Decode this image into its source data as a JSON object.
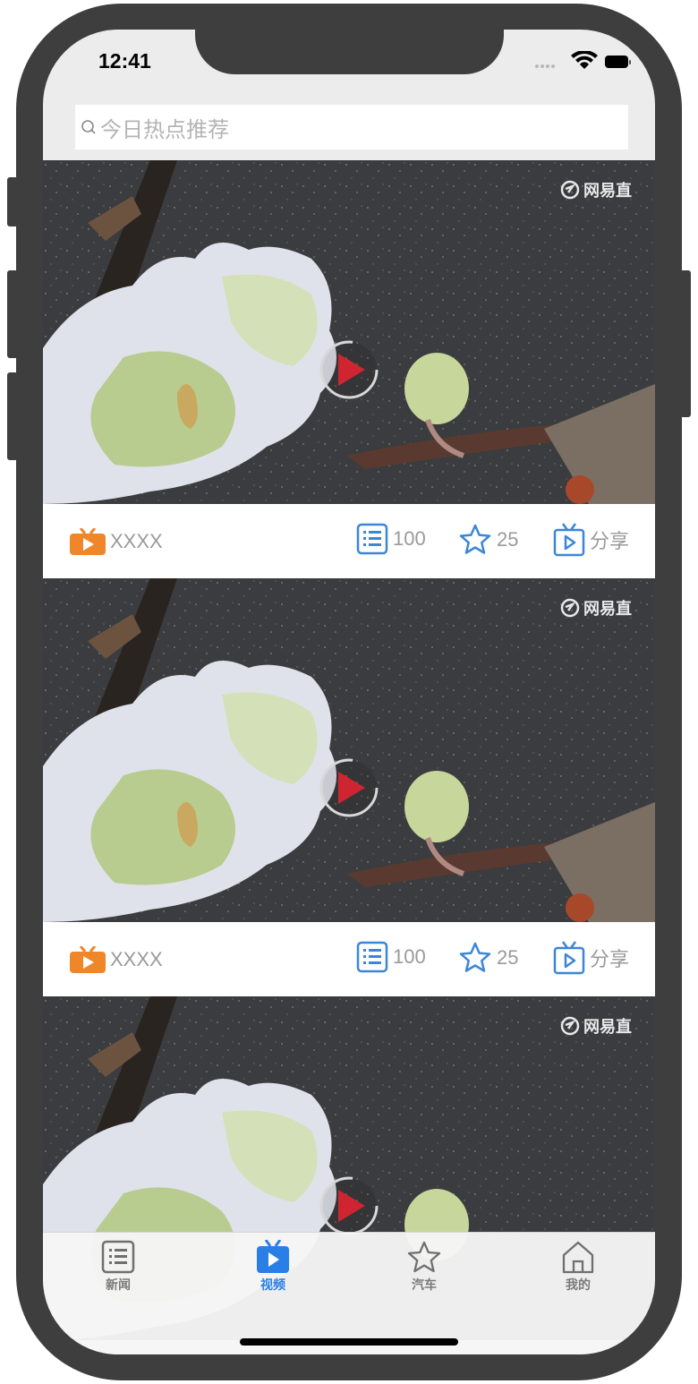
{
  "status_bar": {
    "time": "12:41"
  },
  "search": {
    "placeholder": "今日热点推荐"
  },
  "feed": {
    "watermark": "网易直",
    "items": [
      {
        "channel": "XXXX",
        "comments": "100",
        "stars": "25",
        "share_label": "分享"
      },
      {
        "channel": "XXXX",
        "comments": "100",
        "stars": "25",
        "share_label": "分享"
      },
      {
        "channel": "",
        "comments": "",
        "stars": "",
        "share_label": ""
      }
    ]
  },
  "tab_bar": {
    "tabs": [
      {
        "label": "新闻",
        "icon": "list-icon"
      },
      {
        "label": "视频",
        "icon": "tv-play-icon"
      },
      {
        "label": "汽车",
        "icon": "star-icon"
      },
      {
        "label": "我的",
        "icon": "home-icon"
      }
    ],
    "active_index": 1
  },
  "colors": {
    "accent": "#2a7fe6",
    "channel_icon": "#f0862a",
    "play_red": "#cf2530"
  }
}
